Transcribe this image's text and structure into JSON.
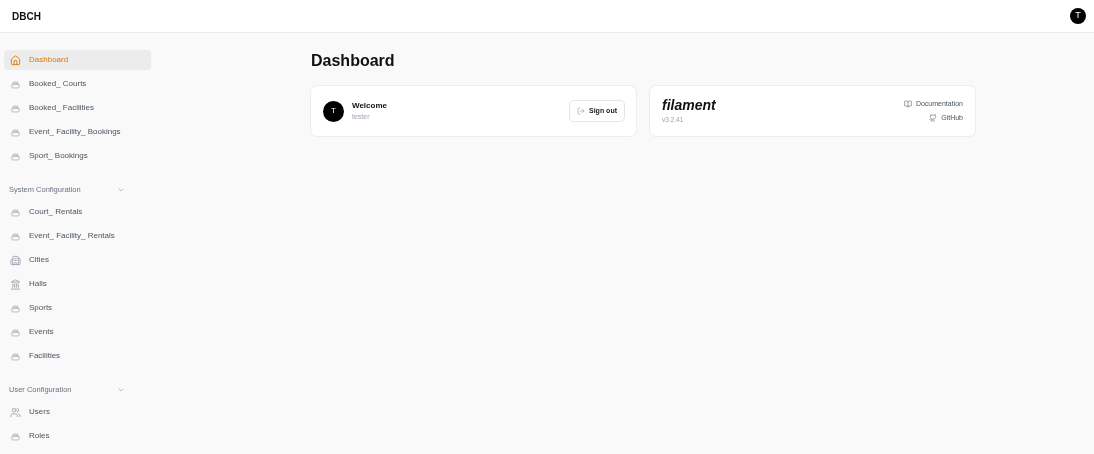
{
  "brand": "DBCH",
  "user_menu": {
    "initial": "T"
  },
  "sidebar": {
    "groups": [
      {
        "items": [
          {
            "label": "Dashboard",
            "selected": true
          },
          {
            "label": "Booked_ Courts",
            "selected": false
          },
          {
            "label": "Booked_ Facilities",
            "selected": false
          },
          {
            "label": "Event_ Facility_ Bookings",
            "selected": false
          },
          {
            "label": "Sport_ Bookings",
            "selected": false
          }
        ]
      },
      {
        "label": "System Configuration",
        "expanded": true,
        "items": [
          {
            "label": "Court_ Rentals",
            "selected": false
          },
          {
            "label": "Event_ Facility_ Rentals",
            "selected": false
          },
          {
            "label": "Cities",
            "selected": false
          },
          {
            "label": "Halls",
            "selected": false
          },
          {
            "label": "Sports",
            "selected": false
          },
          {
            "label": "Events",
            "selected": false
          },
          {
            "label": "Facilities",
            "selected": false
          }
        ]
      },
      {
        "label": "User Configuration",
        "expanded": true,
        "items": [
          {
            "label": "Users",
            "selected": false
          },
          {
            "label": "Roles",
            "selected": false
          }
        ]
      }
    ]
  },
  "page": {
    "title": "Dashboard"
  },
  "account_widget": {
    "avatar_initial": "T",
    "heading": "Welcome",
    "name": "tester",
    "button": "Sign out"
  },
  "info_widget": {
    "logo": "filament",
    "version": "v3.2.41",
    "links": [
      "Documentation",
      "GitHub"
    ]
  }
}
